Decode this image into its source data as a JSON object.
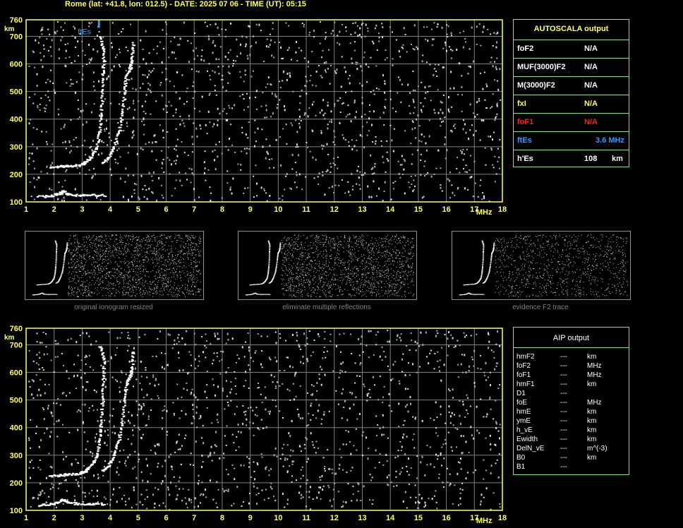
{
  "header": {
    "title": "Rome (lat: +41.8, lon: 012.5) - DATE: 2025 07 06 - TIME (UT): 05:15"
  },
  "colors": {
    "axis": "#ffff66",
    "grid": "#808080",
    "panel_border": "#8fdc8f",
    "fte": "#3399ff",
    "fof1": "#ff2020"
  },
  "chart_data": [
    {
      "type": "scatter",
      "name": "main-ionogram",
      "xlabel": "MHz",
      "ylabel": "km",
      "xlim": [
        1,
        18
      ],
      "ylim": [
        100,
        760
      ],
      "x_ticks": [
        "1",
        "2",
        "3",
        "4",
        "5",
        "6",
        "7",
        "8",
        "9",
        "10",
        "11",
        "12",
        "13",
        "14",
        "15",
        "16",
        "17",
        "18"
      ],
      "y_ticks": [
        "100",
        "200",
        "300",
        "400",
        "500",
        "600",
        "700",
        "760"
      ],
      "annotation": "ftEs",
      "ftEs_marker_x": 3.6,
      "traces": {
        "E_layer": [
          [
            1.4,
            120
          ],
          [
            1.8,
            123
          ],
          [
            2.1,
            130
          ],
          [
            2.3,
            140
          ],
          [
            2.5,
            128
          ],
          [
            2.9,
            125
          ],
          [
            3.3,
            126
          ],
          [
            3.8,
            125
          ]
        ],
        "F_low_ord": [
          [
            1.8,
            225
          ],
          [
            2.2,
            230
          ],
          [
            2.5,
            232
          ],
          [
            2.9,
            236
          ],
          [
            3.1,
            245
          ],
          [
            3.3,
            265
          ],
          [
            3.5,
            300
          ],
          [
            3.6,
            360
          ],
          [
            3.65,
            420
          ],
          [
            3.7,
            500
          ],
          [
            3.72,
            580
          ],
          [
            3.75,
            650
          ],
          [
            3.6,
            700
          ]
        ],
        "F_high_ext": [
          [
            3.7,
            245
          ],
          [
            3.9,
            260
          ],
          [
            4.1,
            300
          ],
          [
            4.3,
            360
          ],
          [
            4.4,
            420
          ],
          [
            4.5,
            500
          ],
          [
            4.55,
            560
          ],
          [
            4.7,
            590
          ],
          [
            4.75,
            620
          ],
          [
            4.8,
            680
          ]
        ]
      }
    },
    {
      "type": "scatter",
      "name": "aip-ionogram",
      "xlabel": "MHz",
      "ylabel": "km",
      "xlim": [
        1,
        18
      ],
      "ylim": [
        100,
        760
      ],
      "x_ticks": [
        "1",
        "2",
        "3",
        "4",
        "5",
        "6",
        "7",
        "8",
        "9",
        "10",
        "11",
        "12",
        "13",
        "14",
        "15",
        "16",
        "17",
        "18"
      ],
      "y_ticks": [
        "100",
        "200",
        "300",
        "400",
        "500",
        "600",
        "700",
        "760"
      ]
    }
  ],
  "thumbnails": [
    {
      "caption": "original ionogram resized"
    },
    {
      "caption": "eliminate multiple reflections"
    },
    {
      "caption": "evidence F2 trace"
    }
  ],
  "autoscala": {
    "title": "AUTOSCALA output",
    "rows": [
      {
        "label": "foF2",
        "value": "N/A",
        "color": "#ffffff"
      },
      {
        "label": "MUF(3000)F2",
        "value": "N/A",
        "color": "#ffffff"
      },
      {
        "label": "M(3000)F2",
        "value": "N/A",
        "color": "#ffffff"
      },
      {
        "label": "fxI",
        "value": "N/A",
        "color": "#ffff66"
      },
      {
        "label": "foF1",
        "value": "N/A",
        "color": "#ff2020"
      },
      {
        "label": "ftEs",
        "value": "3.6  MHz",
        "color": "#3399ff"
      },
      {
        "label": "h'Es",
        "value": "108",
        "unit": "km",
        "color": "#ffffff"
      }
    ]
  },
  "aip": {
    "title": "AIP output",
    "rows": [
      {
        "label": "hmF2",
        "value": "---",
        "unit": "km"
      },
      {
        "label": "foF2",
        "value": "---",
        "unit": "MHz"
      },
      {
        "label": "foF1",
        "value": "---",
        "unit": "MHz"
      },
      {
        "label": "hmF1",
        "value": "---",
        "unit": "km"
      },
      {
        "label": "D1",
        "value": "---",
        "unit": ""
      },
      {
        "label": "foE",
        "value": "---",
        "unit": "MHz"
      },
      {
        "label": "hmE",
        "value": "---",
        "unit": "km"
      },
      {
        "label": "ymE",
        "value": "---",
        "unit": "km"
      },
      {
        "label": "h_vE",
        "value": "---",
        "unit": "km"
      },
      {
        "label": "Ewidth",
        "value": "---",
        "unit": "km"
      },
      {
        "label": "DelN_vE",
        "value": "---",
        "unit": "m^(-3)"
      },
      {
        "label": "B0",
        "value": "---",
        "unit": "km"
      },
      {
        "label": "B1",
        "value": "---",
        "unit": ""
      }
    ]
  }
}
